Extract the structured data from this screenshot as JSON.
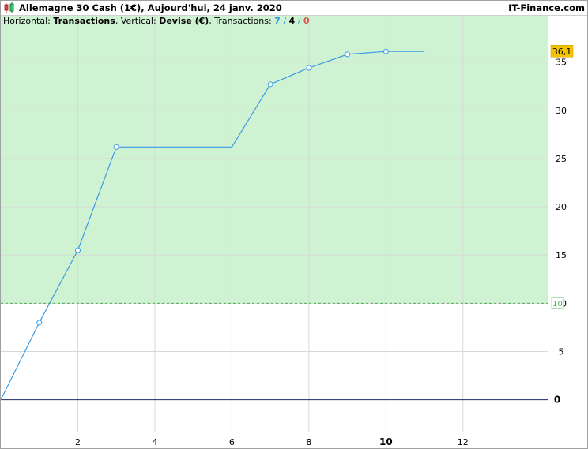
{
  "window": {
    "title": "Allemagne 30 Cash (1€), Aujourd'hui, 24 janv. 2020",
    "site": "IT-Finance.com"
  },
  "info": {
    "horizontal_label": "Horizontal:",
    "horizontal_value": "Transactions",
    "vertical_label": "Vertical:",
    "vertical_value": "Devise (€)",
    "transactions_label": "Transactions:",
    "count_total": "7",
    "count_win": "4",
    "count_loss": "0",
    "separator": "/"
  },
  "colors": {
    "profit_zone": "#cff2d2",
    "line": "#3a9be6",
    "zero_line": "#1f2a6b",
    "threshold": "#4caf50",
    "last_value_badge": "#f5c400"
  },
  "chart_data": {
    "type": "line",
    "x": [
      0,
      1,
      2,
      3,
      6,
      7,
      8,
      9,
      10,
      11
    ],
    "y": [
      0,
      8,
      15.5,
      26.2,
      26.2,
      32.7,
      34.4,
      35.8,
      36.1,
      36.1
    ],
    "markers_x": [
      1,
      2,
      3,
      7,
      8,
      9,
      10
    ],
    "xlim": [
      0,
      14.2
    ],
    "ylim": [
      -3.3,
      39.8
    ],
    "x_ticks": [
      2,
      4,
      6,
      8,
      10,
      12
    ],
    "x_ticks_bold": [
      10
    ],
    "y_ticks": [
      5,
      10,
      15,
      20,
      25,
      30,
      35
    ],
    "y_tick_labels": [
      "5",
      "10",
      "15",
      "20",
      "25",
      "30",
      "35"
    ],
    "zero_label": "0",
    "threshold_value": 10,
    "threshold_label": "10",
    "last_value": 36.1,
    "last_value_label": "36,1",
    "grid": true
  }
}
